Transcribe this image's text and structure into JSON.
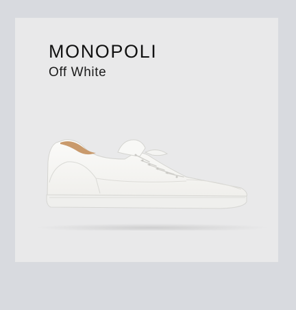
{
  "product": {
    "name": "MONOPOLI",
    "color": "Off White",
    "image_icon": "white-leather-sneaker",
    "colors": {
      "page_background": "#d8dadf",
      "card_background": "#e9e9ea",
      "shoe_upper": "#f7f6f3",
      "shoe_sole": "#eeeeec",
      "lining": "#c99a6c"
    }
  }
}
